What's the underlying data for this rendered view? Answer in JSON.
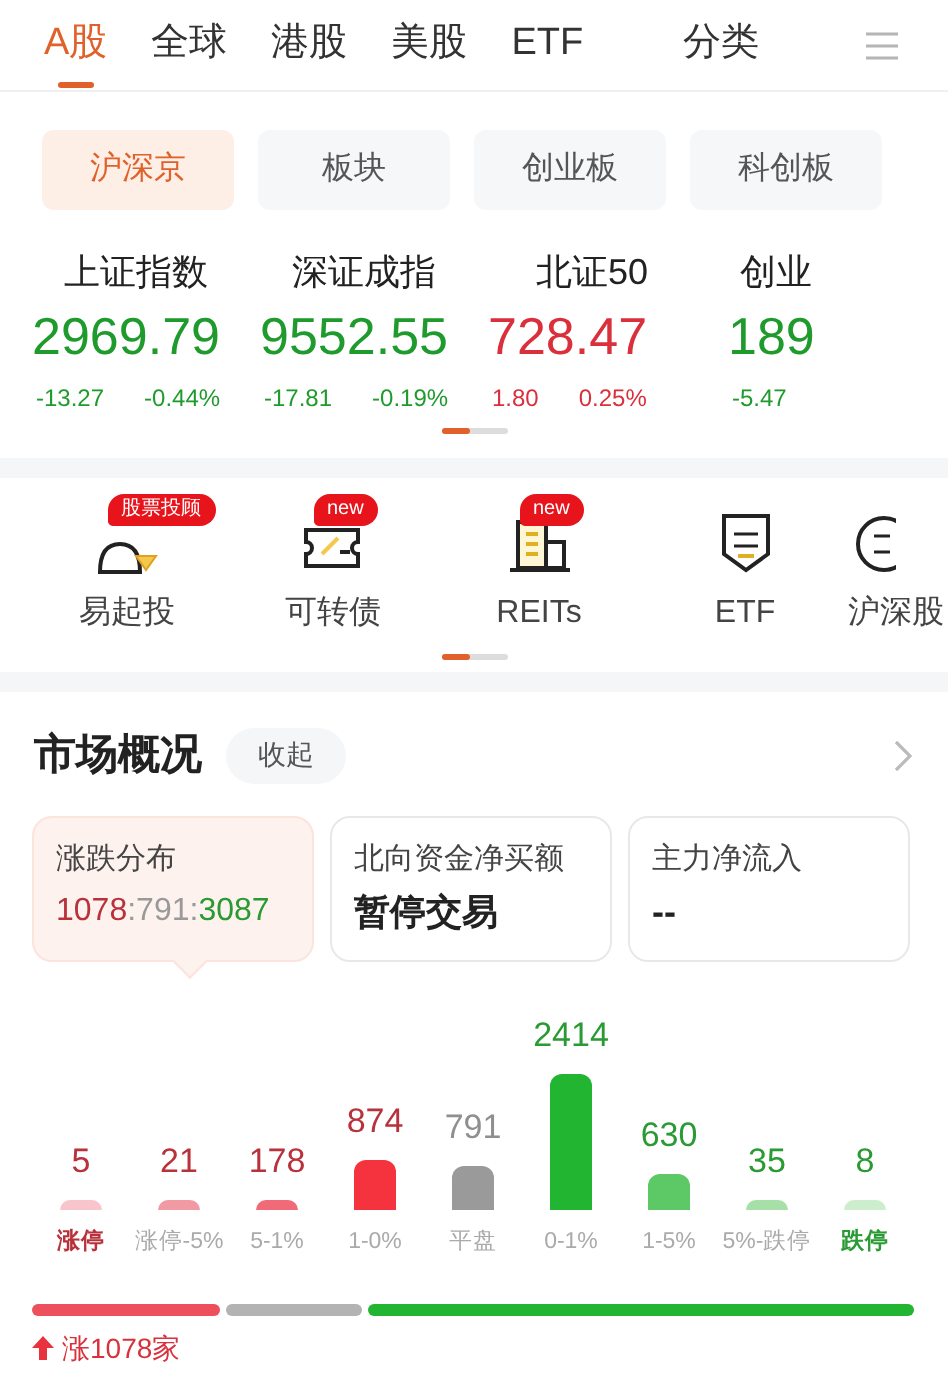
{
  "top_tabs": [
    {
      "label": "A股",
      "selected": true
    },
    {
      "label": "全球",
      "selected": false
    },
    {
      "label": "港股",
      "selected": false
    },
    {
      "label": "美股",
      "selected": false
    },
    {
      "label": "ETF",
      "selected": false
    },
    {
      "label": "分类",
      "selected": false
    }
  ],
  "sub_tabs": [
    {
      "label": "沪深京",
      "selected": true
    },
    {
      "label": "板块",
      "selected": false
    },
    {
      "label": "创业板",
      "selected": false
    },
    {
      "label": "科创板",
      "selected": false
    }
  ],
  "indices": [
    {
      "name": "上证指数",
      "value": "2969.79",
      "change": "-13.27",
      "percent": "-0.44%",
      "color": "#1f9a2c"
    },
    {
      "name": "深证成指",
      "value": "9552.55",
      "change": "-17.81",
      "percent": "-0.19%",
      "color": "#1f9a2c"
    },
    {
      "name": "北证50",
      "value": "728.47",
      "change": "1.80",
      "percent": "0.25%",
      "color": "#d9303c"
    },
    {
      "name": "创业",
      "value": "189",
      "change": "-5.47",
      "color": "#1f9a2c"
    }
  ],
  "shortcuts": [
    {
      "label": "易起投",
      "badge": "股票投顾"
    },
    {
      "label": "可转债",
      "badge": "new"
    },
    {
      "label": "REITs",
      "badge": "new"
    },
    {
      "label": "ETF"
    },
    {
      "label": "沪深股"
    }
  ],
  "market": {
    "title": "市场概况",
    "collapse": "收起",
    "cards": [
      {
        "title": "涨跌分布",
        "kind": "ratio",
        "parts": [
          {
            "text": "1078",
            "color": "#b8323c"
          },
          {
            "text": ":791:",
            "color": "#999999"
          },
          {
            "text": "3087",
            "color": "#2a9a34"
          }
        ],
        "selected": true
      },
      {
        "title": "北向资金净买额",
        "kind": "text",
        "value": "暂停交易",
        "selected": false
      },
      {
        "title": "主力净流入",
        "kind": "text",
        "value": "--",
        "selected": false
      }
    ],
    "distribution": [
      {
        "label": "涨停",
        "count": "5",
        "color": "#f7c5cb",
        "kind": "limitup"
      },
      {
        "label": "涨停-5%",
        "count": "21",
        "color": "#f29aa3",
        "kind": "up"
      },
      {
        "label": "5-1%",
        "count": "178",
        "color": "#f06b77",
        "kind": "up"
      },
      {
        "label": "1-0%",
        "count": "874",
        "color": "#f5333f",
        "kind": "up"
      },
      {
        "label": "平盘",
        "count": "791",
        "color": "#9a9a9a",
        "kind": "flat"
      },
      {
        "label": "0-1%",
        "count": "2414",
        "color": "#22b532",
        "kind": "down"
      },
      {
        "label": "1-5%",
        "count": "630",
        "color": "#5cc866",
        "kind": "down"
      },
      {
        "label": "5%-跌停",
        "count": "35",
        "color": "#a6dfa8",
        "kind": "down"
      },
      {
        "label": "跌停",
        "count": "8",
        "color": "#cdeecd",
        "kind": "limitdown"
      }
    ],
    "breadth": {
      "caption": "涨1078家"
    }
  }
}
